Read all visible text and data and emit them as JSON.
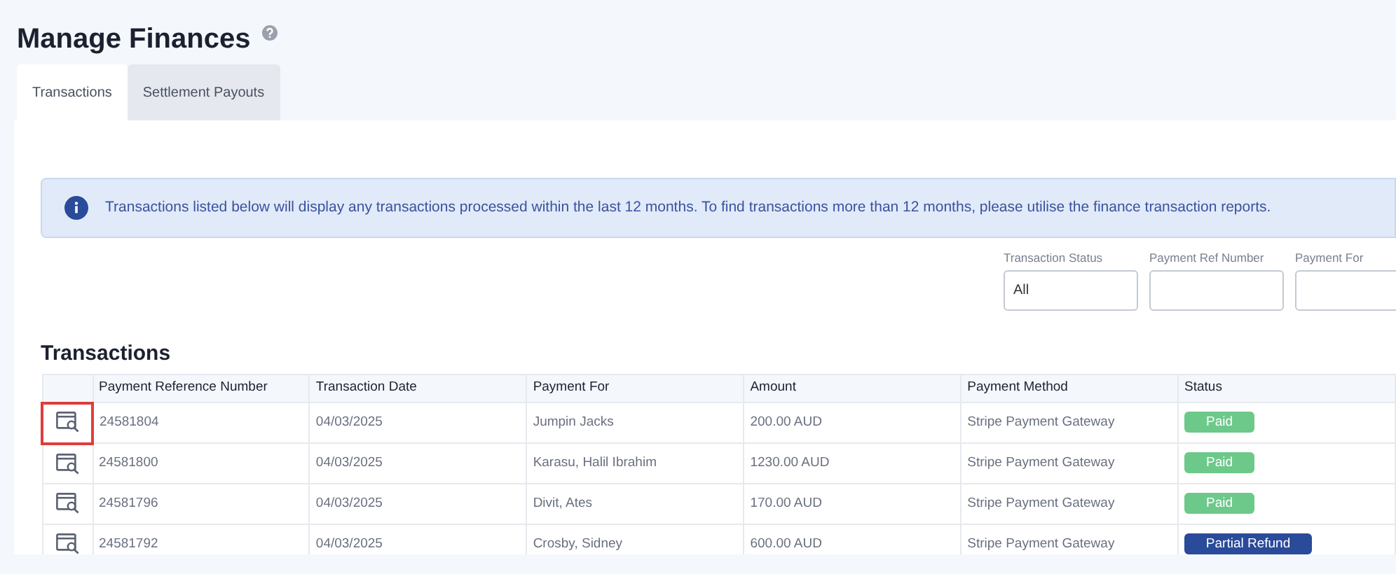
{
  "page": {
    "title": "Manage Finances"
  },
  "tabs": [
    {
      "label": "Transactions",
      "selected": true
    },
    {
      "label": "Settlement Payouts",
      "selected": false
    }
  ],
  "info_banner": {
    "text": "Transactions listed below will display any transactions processed within the last 12 months. To find transactions more than 12 months, please utilise the finance transaction reports."
  },
  "filters": [
    {
      "label": "Transaction Status",
      "value": "All"
    },
    {
      "label": "Payment Ref Number"
    },
    {
      "label": "Payment For"
    }
  ],
  "table": {
    "title": "Transactions",
    "columns": [
      "Payment Reference Number",
      "Transaction Date",
      "Payment For",
      "Amount",
      "Payment Method",
      "Status"
    ],
    "rows": [
      {
        "highlighted": true,
        "cells": [
          "24581804",
          "04/03/2025",
          "Jumpin Jacks",
          "200.00 AUD",
          "Stripe Payment Gateway"
        ],
        "status": {
          "kind": "paid",
          "label": "Paid"
        }
      },
      {
        "highlighted": false,
        "cells": [
          "24581800",
          "04/03/2025",
          "Karasu, Halil Ibrahim",
          "1230.00 AUD",
          "Stripe Payment Gateway"
        ],
        "status": {
          "kind": "paid",
          "label": "Paid"
        }
      },
      {
        "highlighted": false,
        "cells": [
          "24581796",
          "04/03/2025",
          "Divit, Ates",
          "170.00 AUD",
          "Stripe Payment Gateway"
        ],
        "status": {
          "kind": "paid",
          "label": "Paid"
        }
      },
      {
        "highlighted": false,
        "cells": [
          "24581792",
          "04/03/2025",
          "Crosby, Sidney",
          "600.00 AUD",
          "Stripe Payment Gateway"
        ],
        "status": {
          "kind": "refund",
          "label": "Partial Refund"
        }
      }
    ]
  }
}
